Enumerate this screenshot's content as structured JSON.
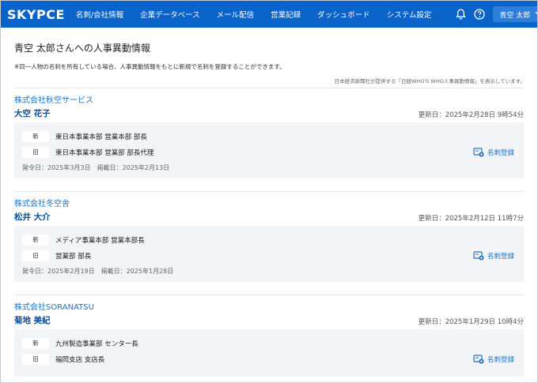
{
  "header": {
    "logo": "SKYPCE",
    "nav": [
      "名刺/会社情報",
      "企業データベース",
      "メール配信",
      "営業記録",
      "ダッシュボード",
      "システム設定"
    ],
    "user_name": "青空 太郎"
  },
  "page": {
    "title": "青空 太郎さんへの人事異動情報",
    "notice": "※同一人物の名刺を所有している場合、人事異動情報をもとに新規で名刺を登録することができます。",
    "source_note": "日本経済新聞社が提供する「日経WHO'S WHO人事異動情報」を表示しています。"
  },
  "entries": [
    {
      "company": "株式会社秋空サービス",
      "person": "大空 花子",
      "updated": "更新日：2025年2月28日 9時54分",
      "new_tag": "新",
      "new_position": "東日本事業本部 営業本部 部長",
      "old_tag": "旧",
      "old_position": "東日本事業本部 営業部 部長代理",
      "dates": "発令日：2025年3月3日　掲載日：2025年2月13日",
      "register_label": "名刺登録"
    },
    {
      "company": "株式会社冬空舎",
      "person": "松井 大介",
      "updated": "更新日：2025年2月12日 11時7分",
      "new_tag": "新",
      "new_position": "メディア事業本部 営業本部長",
      "old_tag": "旧",
      "old_position": "営業部 部長",
      "dates": "発令日：2025年2月19日　掲載日：2025年1月28日",
      "register_label": "名刺登録"
    },
    {
      "company": "株式会社SORANATSU",
      "person": "菊地 美紀",
      "updated": "更新日：2025年1月29日 10時4分",
      "new_tag": "新",
      "new_position": "九州製造事業部 センター長",
      "old_tag": "旧",
      "old_position": "福岡支店 支店長",
      "dates": "",
      "register_label": "名刺登録"
    }
  ],
  "colors": {
    "header_bg": "#0a63c9",
    "link": "#1a73c7",
    "card_bg": "#f2f4f7"
  }
}
